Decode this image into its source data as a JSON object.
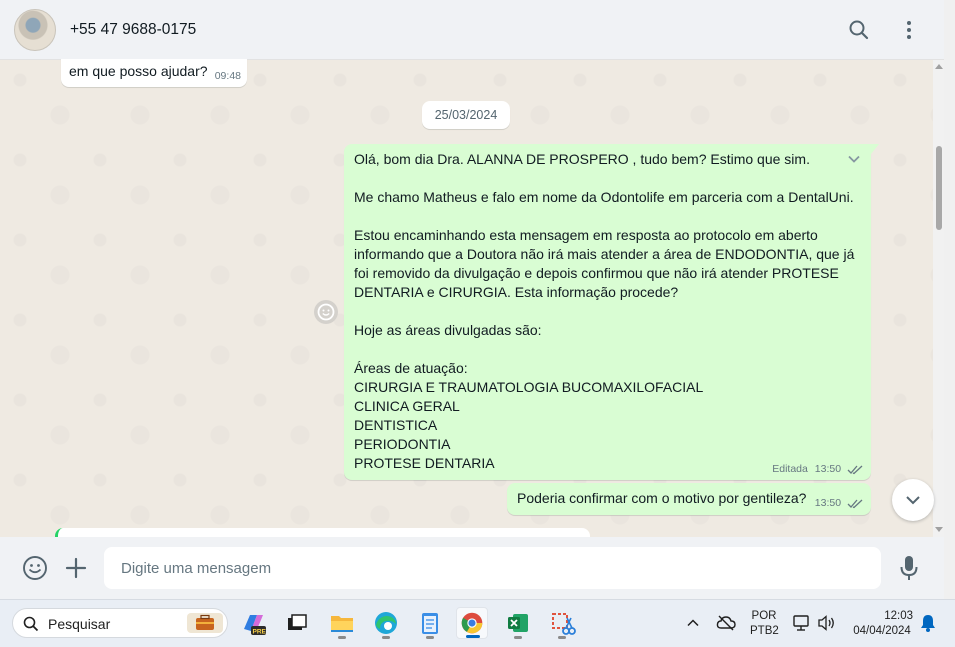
{
  "header": {
    "contact_name": "+55 47 9688-0175",
    "icons": [
      "avatar",
      "search-icon",
      "menu-icon"
    ]
  },
  "chat": {
    "prev_message": {
      "text": "em que posso ajudar?",
      "time": "09:48"
    },
    "date_chip": "25/03/2024",
    "outgoing_message": {
      "lines": [
        "Olá, bom dia Dra. ALANNA DE PROSPERO , tudo bem? Estimo que sim.",
        "",
        "Me chamo Matheus e falo em nome da Odontolife em parceria com a DentalUni.",
        "",
        "Estou encaminhando esta mensagem em resposta ao protocolo em aberto",
        "informando que a Doutora não irá mais atender a área de ENDODONTIA, que já",
        "foi removido da divulgação e depois confirmou que não irá atender PROTESE",
        "DENTARIA e CIRURGIA. Esta informação procede?",
        "",
        "Hoje as áreas divulgadas são:",
        "",
        "Áreas de atuação:",
        "CIRURGIA E TRAUMATOLOGIA BUCOMAXILOFACIAL",
        "CLINICA GERAL",
        "DENTISTICA",
        "PERIODONTIA",
        "PROTESE DENTARIA"
      ],
      "edited_label": "Editada",
      "time": "13:50",
      "status": "read"
    },
    "outgoing_message_2": {
      "text": "Poderia confirmar com o motivo por gentileza?",
      "time": "13:50",
      "status": "read"
    }
  },
  "compose": {
    "placeholder": "Digite uma mensagem",
    "value": "",
    "icons": [
      "emoji-icon",
      "attach-plus-icon",
      "microphone-icon"
    ]
  },
  "taskbar": {
    "search_label": "Pesquisar",
    "apps": [
      "briefcase",
      "copilot-pre",
      "task-view",
      "file-explorer",
      "edge",
      "notepad",
      "chrome",
      "excel",
      "snipping-tool"
    ],
    "active_app": "chrome",
    "tray": {
      "language": "POR",
      "layout": "PTB2",
      "time": "12:03",
      "date": "04/04/2024"
    }
  },
  "colors": {
    "outgoing_bubble": "#d9fdd3",
    "incoming_bubble": "#ffffff",
    "chat_bg": "#efeae2",
    "panel_bg": "#f0f2f5",
    "read_ticks": "#667781"
  }
}
